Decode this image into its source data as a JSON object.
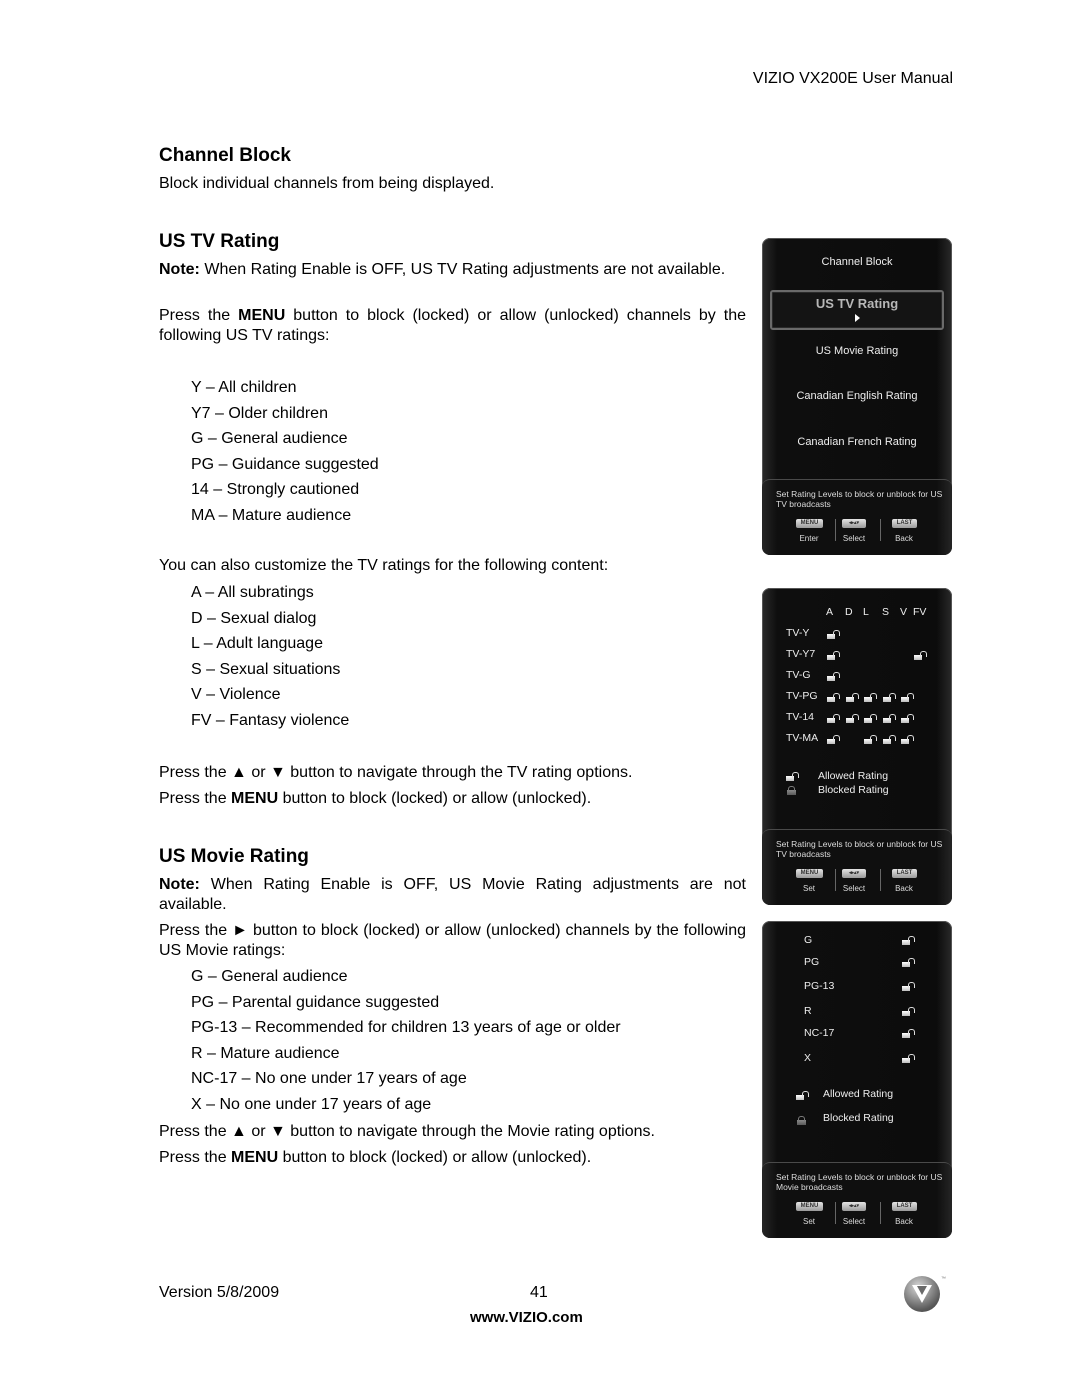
{
  "header": {
    "title": "VIZIO VX200E User Manual"
  },
  "channel_block": {
    "heading": "Channel Block",
    "description": "Block individual channels from being displayed."
  },
  "us_tv_rating": {
    "heading": "US TV Rating",
    "note_label": "Note:",
    "note_text": " When Rating Enable is OFF, US TV Rating adjustments are not available.",
    "press_pre": "Press the ",
    "press_key": "MENU",
    "press_post": " button to block (locked) or allow (unlocked) channels by the following US TV ratings:",
    "ratings": [
      "Y – All children",
      "Y7 – Older children",
      "G – General audience",
      "PG – Guidance suggested",
      "14 – Strongly cautioned",
      "MA – Mature audience"
    ],
    "content_intro": "You can also customize the TV ratings for the following content:",
    "content": [
      "A – All subratings",
      "D – Sexual dialog",
      "L – Adult language",
      "S – Sexual situations",
      "V – Violence",
      "FV – Fantasy violence"
    ],
    "nav_text": "Press the ▲ or ▼ button to navigate through the TV rating options.",
    "menu_pre": "Press the ",
    "menu_key": "MENU",
    "menu_post": " button to block (locked) or allow (unlocked)."
  },
  "us_movie_rating": {
    "heading": "US Movie Rating",
    "note_label": "Note:",
    "note_text": " When Rating Enable is OFF, US Movie Rating adjustments are not available.",
    "press_text": "Press the ► button to block (locked) or allow (unlocked) channels by the following US Movie ratings:",
    "ratings": [
      "G – General audience",
      "PG – Parental guidance suggested",
      "PG-13 – Recommended for children 13 years of age or older",
      "R – Mature audience",
      "NC-17 – No one under 17 years of age",
      "X – No one under 17 years of age"
    ],
    "nav_text": "Press the ▲ or  ▼ button to navigate through the Movie rating options.",
    "menu_pre": "Press the ",
    "menu_key": "MENU",
    "menu_post": " button to block (locked) or allow (unlocked)."
  },
  "screen_menu": {
    "items": [
      "Channel Block",
      "US TV Rating",
      "US Movie Rating",
      "Canadian English Rating",
      "Canadian French Rating"
    ],
    "selected": "US TV Rating",
    "hint": "Set Rating Levels to block or unblock for US TV broadcasts",
    "buttons": [
      {
        "key": "MENU",
        "label": "Enter",
        "icon": "menu-key-icon"
      },
      {
        "key": "◂▸▴▾",
        "label": "Select",
        "icon": "arrow-keys-icon"
      },
      {
        "key": "LAST",
        "label": "Back",
        "icon": "last-key-icon"
      }
    ]
  },
  "screen_tv_grid": {
    "columns": [
      "A",
      "D",
      "L",
      "S",
      "V",
      "FV"
    ],
    "rows": [
      {
        "label": "TV-Y",
        "cells": [
          "allowed",
          null,
          null,
          null,
          null,
          null
        ]
      },
      {
        "label": "TV-Y7",
        "cells": [
          "allowed",
          null,
          null,
          null,
          null,
          "allowed"
        ]
      },
      {
        "label": "TV-G",
        "cells": [
          "allowed",
          null,
          null,
          null,
          null,
          null
        ]
      },
      {
        "label": "TV-PG",
        "cells": [
          "allowed",
          "allowed",
          "allowed",
          "allowed",
          "allowed",
          null
        ]
      },
      {
        "label": "TV-14",
        "cells": [
          "allowed",
          "allowed",
          "allowed",
          "allowed",
          "allowed",
          null
        ]
      },
      {
        "label": "TV-MA",
        "cells": [
          "allowed",
          null,
          "allowed",
          "allowed",
          "allowed",
          null
        ]
      }
    ],
    "legend": {
      "allowed": "Allowed Rating",
      "blocked": "Blocked Rating"
    },
    "hint": "Set Rating Levels to block or unblock for US TV broadcasts",
    "buttons": [
      {
        "key": "MENU",
        "label": "Set"
      },
      {
        "key": "◂▸▴▾",
        "label": "Select"
      },
      {
        "key": "LAST",
        "label": "Back"
      }
    ]
  },
  "screen_movie_grid": {
    "rows": [
      {
        "label": "G",
        "state": "allowed"
      },
      {
        "label": "PG",
        "state": "allowed"
      },
      {
        "label": "PG-13",
        "state": "allowed"
      },
      {
        "label": "R",
        "state": "allowed"
      },
      {
        "label": "NC-17",
        "state": "allowed"
      },
      {
        "label": "X",
        "state": "allowed"
      }
    ],
    "legend": {
      "allowed": "Allowed Rating",
      "blocked": "Blocked Rating"
    },
    "hint": "Set Rating Levels to block or unblock for US Movie broadcasts",
    "buttons": [
      {
        "key": "MENU",
        "label": "Set"
      },
      {
        "key": "◂▸▴▾",
        "label": "Select"
      },
      {
        "key": "LAST",
        "label": "Back"
      }
    ]
  },
  "footer": {
    "version": "Version 5/8/2009",
    "page_number": "41",
    "url": "www.VIZIO.com",
    "logo_tm": "™"
  }
}
